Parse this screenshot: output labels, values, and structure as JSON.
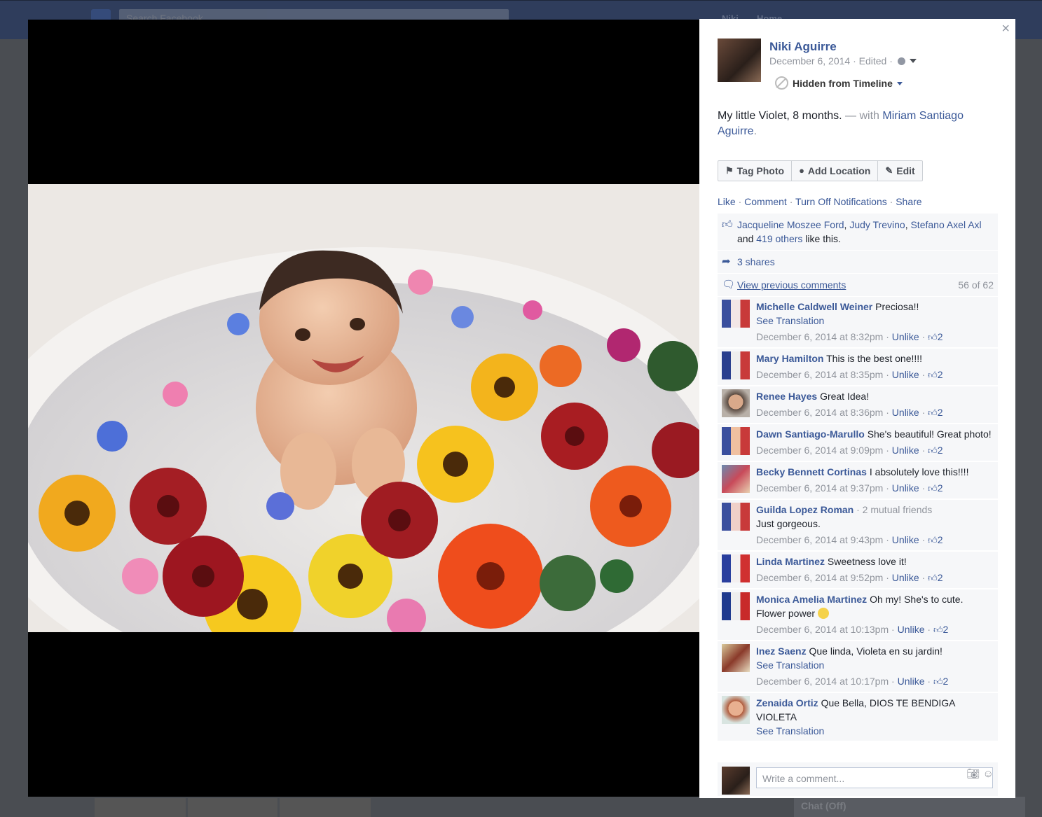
{
  "background": {
    "search_placeholder": "Search Facebook",
    "nav_user": "Niki",
    "nav_home": "Home",
    "chat_label": "Chat (Off)"
  },
  "photo": {
    "description_icon": "baby-in-flower-milk-bath-photo"
  },
  "post": {
    "owner": "Niki Aguirre",
    "date": "December 6, 2014",
    "edited": "Edited",
    "sep": "·",
    "hidden_label": "Hidden from Timeline",
    "caption": "My little Violet, 8 months.",
    "with_prefix": " — with ",
    "with_name": "Miriam Santiago Aguirre",
    "with_suffix": ".",
    "close_label": "×"
  },
  "buttons": {
    "tag_photo": "Tag Photo",
    "add_location": "Add Location",
    "edit": "Edit"
  },
  "actions": {
    "like": "Like",
    "comment": "Comment",
    "turn_off": "Turn Off Notifications",
    "share": "Share"
  },
  "likes": {
    "name1": "Jacqueline Moszee Ford",
    "name2": "Judy Trevino",
    "name3": "Stefano Axel Axl",
    "and": " and ",
    "others": "419 others",
    "tail": " like this."
  },
  "shares": "3 shares",
  "view_previous": "View previous comments",
  "comment_count": "56 of 62",
  "comments": [
    {
      "name": "Michelle Caldwell Weiner",
      "text": "Preciosa!!",
      "see_translation": "See Translation",
      "time": "December 6, 2014 at 8:32pm",
      "likes": "2"
    },
    {
      "name": "Mary Hamilton",
      "text": "This is the best one!!!!",
      "time": "December 6, 2014 at 8:35pm",
      "likes": "2"
    },
    {
      "name": "Renee Hayes",
      "text": "Great Idea!",
      "time": "December 6, 2014 at 8:36pm",
      "likes": "2"
    },
    {
      "name": "Dawn Santiago-Marullo",
      "text": "She's beautiful! Great photo!",
      "time": "December 6, 2014 at 9:09pm",
      "likes": "2"
    },
    {
      "name": "Becky Bennett Cortinas",
      "text": "I absolutely love this!!!!",
      "time": "December 6, 2014 at 9:37pm",
      "likes": "2"
    },
    {
      "name": "Guilda Lopez Roman",
      "mutual": " · 2 mutual friends",
      "text": "Just gorgeous.",
      "time": "December 6, 2014 at 9:43pm",
      "likes": "2"
    },
    {
      "name": "Linda Martinez",
      "text": "Sweetness love it!",
      "time": "December 6, 2014 at 9:52pm",
      "likes": "2"
    },
    {
      "name": "Monica Amelia Martinez",
      "text": "Oh my! She's to cute. Flower power",
      "time": "December 6, 2014 at 10:13pm",
      "likes": "2"
    },
    {
      "name": "Inez Saenz",
      "text": "Que linda, Violeta en su jardin!",
      "see_translation": "See Translation",
      "time": "December 6, 2014 at 10:17pm",
      "likes": "2"
    },
    {
      "name": "Zenaida Ortiz",
      "text": "Que Bella, DIOS TE BENDIGA VIOLETA",
      "see_translation": "See Translation"
    }
  ],
  "unlike_label": "Unlike",
  "write_placeholder": "Write a comment..."
}
